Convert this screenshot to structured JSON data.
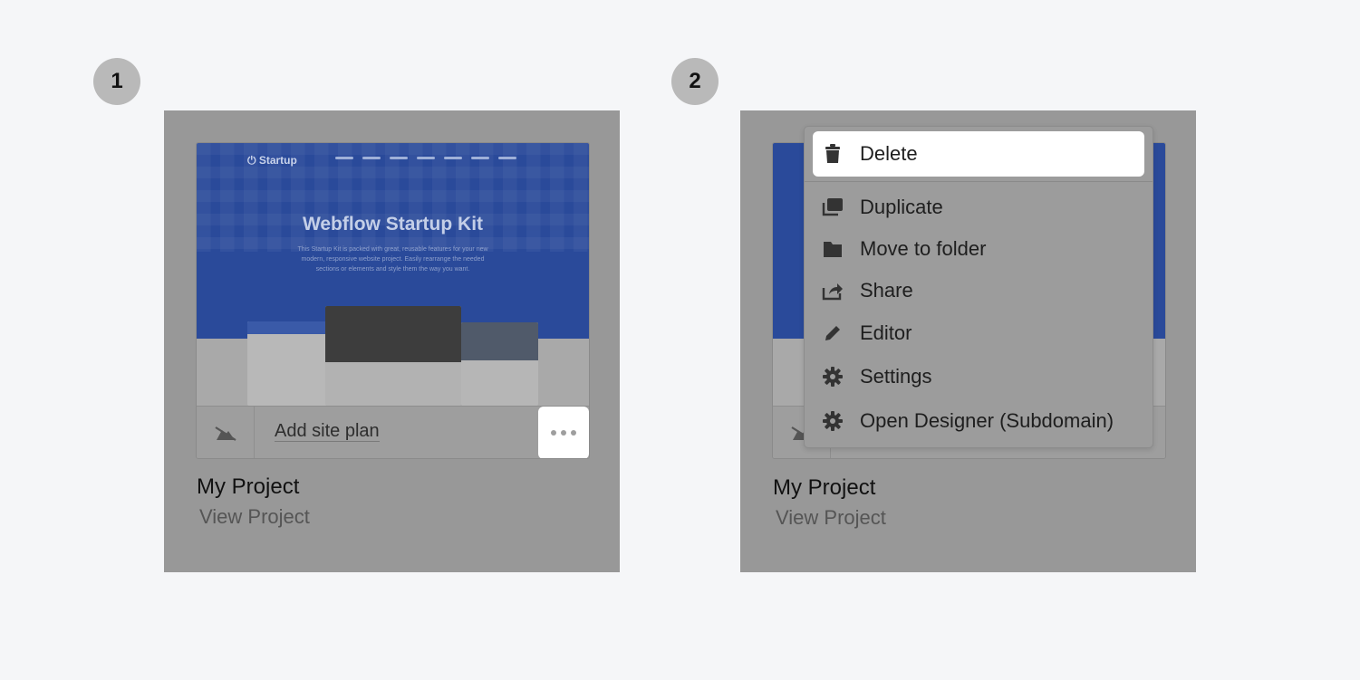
{
  "steps": [
    {
      "number": "1"
    },
    {
      "number": "2"
    }
  ],
  "card": {
    "thumbnail": {
      "logo": "Startup",
      "title": "Webflow Startup Kit",
      "subtitle": "This Startup Kit is packed with great, reusable features for your new modern, responsive website project. Easily rearrange the needed sections or elements and style them the way you want."
    },
    "site_plan_label": "Add site plan",
    "project_title": "My Project",
    "project_link": "View Project"
  },
  "menu": {
    "items": [
      {
        "label": "Delete",
        "icon": "trash-icon"
      },
      {
        "label": "Duplicate",
        "icon": "duplicate-icon"
      },
      {
        "label": "Move to folder",
        "icon": "folder-icon"
      },
      {
        "label": "Share",
        "icon": "share-icon"
      },
      {
        "label": "Editor",
        "icon": "pencil-icon"
      },
      {
        "label": "Settings",
        "icon": "gear-icon"
      },
      {
        "label": "Open Designer (Subdomain)",
        "icon": "gear-icon"
      }
    ]
  },
  "colors": {
    "overlay": "#989898",
    "hero_blue": "#2a4a9a",
    "highlight": "#ffffff"
  }
}
